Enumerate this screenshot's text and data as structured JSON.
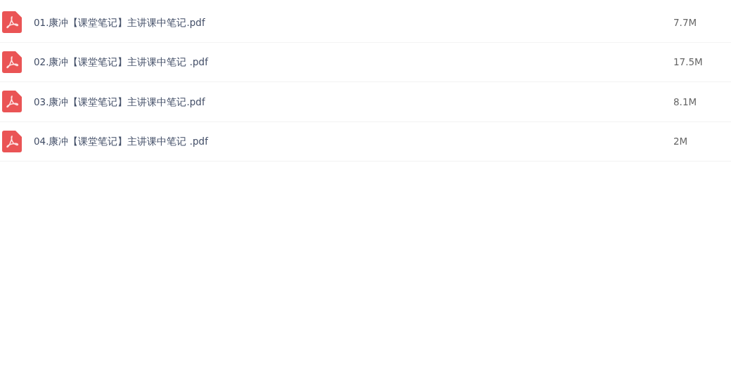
{
  "files": [
    {
      "name": "01.康冲【课堂笔记】主讲课中笔记.pdf",
      "size": "7.7M"
    },
    {
      "name": "02.康冲【课堂笔记】主讲课中笔记 .pdf",
      "size": "17.5M"
    },
    {
      "name": "03.康冲【课堂笔记】主讲课中笔记.pdf",
      "size": "8.1M"
    },
    {
      "name": "04.康冲【课堂笔记】主讲课中笔记 .pdf",
      "size": "2M"
    }
  ]
}
